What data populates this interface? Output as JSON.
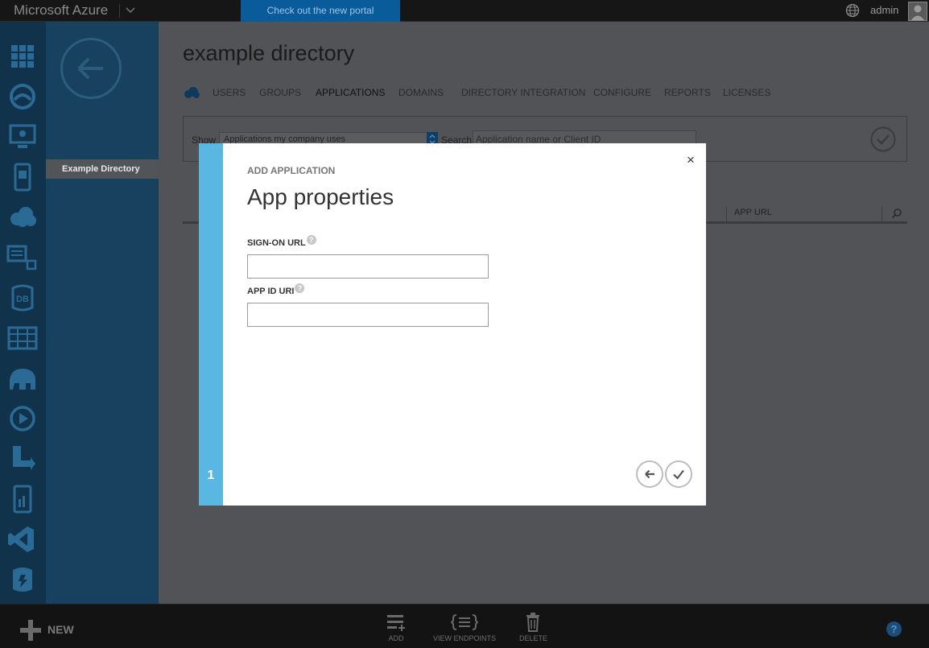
{
  "topbar": {
    "brand": "Microsoft Azure",
    "portal_link": "Check out the new portal",
    "user": "admin",
    "icons": [
      "chevron-down-icon",
      "globe-icon"
    ]
  },
  "iconbar": {
    "items": [
      "all-items-icon",
      "websites-icon",
      "virtual-machines-icon",
      "mobile-services-icon",
      "cloud-services-icon",
      "batch-services-icon",
      "sql-databases-icon",
      "storage-icon",
      "hdinsight-icon",
      "media-services-icon",
      "service-bus-icon",
      "mobile-engagement-icon",
      "visual-studio-icon",
      "cache-icon"
    ]
  },
  "sidebar": {
    "items": [
      {
        "label": "Example Directory",
        "selected": true
      }
    ]
  },
  "main": {
    "title": "example directory",
    "tabs": [
      {
        "label": "USERS"
      },
      {
        "label": "GROUPS"
      },
      {
        "label": "APPLICATIONS",
        "active": true
      },
      {
        "label": "DOMAINS"
      },
      {
        "label": "DIRECTORY INTEGRATION"
      },
      {
        "label": "CONFIGURE"
      },
      {
        "label": "REPORTS"
      },
      {
        "label": "LICENSES"
      }
    ],
    "filter": {
      "show_label": "Show",
      "show_value": "Applications my company uses",
      "search_label": "Search",
      "search_placeholder": "Application name or Client ID"
    },
    "table": {
      "columns": [
        "APP URL"
      ]
    }
  },
  "modal": {
    "eyebrow": "ADD APPLICATION",
    "title": "App properties",
    "step": "1",
    "close_glyph": "×",
    "fields": [
      {
        "label": "SIGN-ON URL",
        "value": "",
        "help": "?"
      },
      {
        "label": "APP ID URI",
        "value": "",
        "help": "?"
      }
    ]
  },
  "bottombar": {
    "new_label": "NEW",
    "commands": [
      {
        "label": "ADD",
        "icon": "add-list-icon"
      },
      {
        "label": "VIEW ENDPOINTS",
        "icon": "endpoints-icon"
      },
      {
        "label": "DELETE",
        "icon": "trash-icon"
      }
    ],
    "help_glyph": "?"
  },
  "colors": {
    "accent_strip": "#59b7e2",
    "iconbar_bg": "#10324a",
    "sidebar_bg": "#17415e",
    "portal_link_bg": "#0a5b99"
  }
}
